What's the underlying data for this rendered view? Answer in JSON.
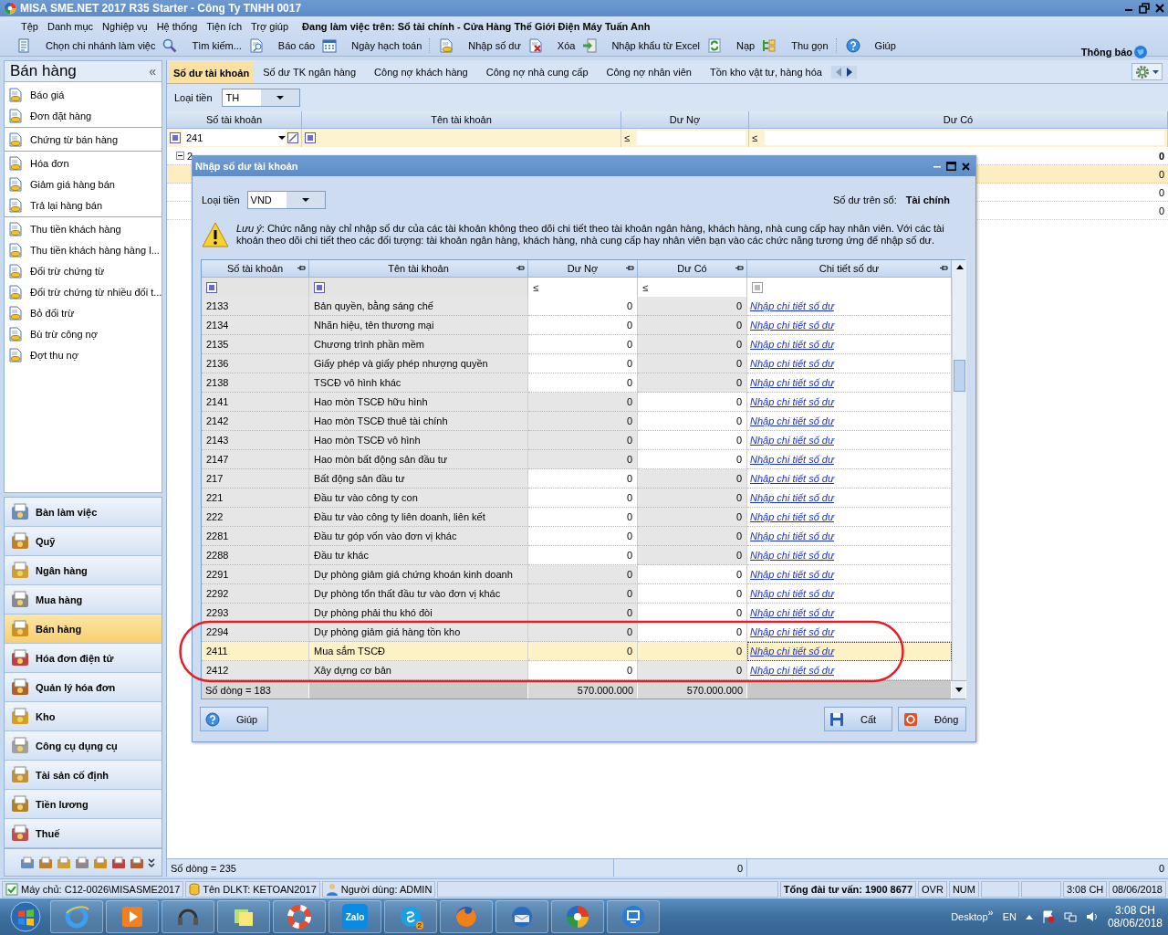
{
  "window": {
    "title": "MISA SME.NET 2017 R35 Starter - Công Ty TNHH 0017"
  },
  "menu": {
    "items": [
      "Tệp",
      "Danh mục",
      "Nghiệp vụ",
      "Hệ thống",
      "Tiện ích",
      "Trợ giúp"
    ],
    "context": "Đang làm việc trên: Sổ tài chính - Cửa Hàng Thế Giới Điện Máy Tuấn Anh"
  },
  "toolbar": {
    "groups": [
      [
        {
          "label": "Chọn chi nhánh làm việc",
          "kind": "branch"
        },
        {
          "label": "Tìm kiếm...",
          "kind": "search"
        },
        {
          "label": "Báo cáo",
          "kind": "report"
        },
        {
          "label": "Ngày hạch toán",
          "kind": "calendar"
        }
      ],
      [
        {
          "label": "Nhập số dư",
          "kind": "balance"
        },
        {
          "label": "Xóa",
          "kind": "delete"
        },
        {
          "label": "Nhập khẩu từ Excel",
          "kind": "import"
        },
        {
          "label": "Nạp",
          "kind": "refresh"
        },
        {
          "label": "Thu gọn",
          "kind": "collapse"
        }
      ],
      [
        {
          "label": "Giúp",
          "kind": "help"
        }
      ]
    ],
    "notification": "Thông báo"
  },
  "sidebar": {
    "title": "Bán hàng",
    "collapse": "«",
    "groups": [
      [
        "Báo giá",
        "Đơn đặt hàng"
      ],
      [
        "Chứng từ bán hàng"
      ],
      [
        "Hóa đơn",
        "Giảm giá hàng bán",
        "Trả lại hàng bán"
      ],
      [
        "Thu tiền khách hàng",
        "Thu tiền khách hàng hàng l...",
        "Đối trừ chứng từ",
        "Đối trừ chứng từ nhiều đối t...",
        "Bỏ đối trừ",
        "Bù trừ công nợ",
        "Đợt thu nợ"
      ]
    ],
    "modules": [
      {
        "label": "Bàn làm việc",
        "selected": false
      },
      {
        "label": "Quỹ",
        "selected": false
      },
      {
        "label": "Ngân hàng",
        "selected": false
      },
      {
        "label": "Mua hàng",
        "selected": false
      },
      {
        "label": "Bán hàng",
        "selected": true
      },
      {
        "label": "Hóa đơn điện tử",
        "selected": false
      },
      {
        "label": "Quản lý hóa đơn",
        "selected": false
      },
      {
        "label": "Kho",
        "selected": false
      },
      {
        "label": "Công cụ dụng cụ",
        "selected": false
      },
      {
        "label": "Tài sản cố định",
        "selected": false
      },
      {
        "label": "Tiền lương",
        "selected": false
      },
      {
        "label": "Thuế",
        "selected": false
      }
    ]
  },
  "tabs": [
    {
      "label": "Số dư tài khoản",
      "selected": true
    },
    {
      "label": "Số dư TK ngân hàng",
      "selected": false
    },
    {
      "label": "Công nợ khách hàng",
      "selected": false
    },
    {
      "label": "Công nợ nhà cung cấp",
      "selected": false
    },
    {
      "label": "Công nợ nhân viên",
      "selected": false
    },
    {
      "label": "Tồn kho vật tư, hàng hóa",
      "selected": false
    }
  ],
  "currency": {
    "label": "Loại tiền",
    "value": "TH"
  },
  "grid": {
    "columns": [
      "Số tài khoản",
      "Tên tài khoản",
      "Dư Nợ",
      "Dư Có"
    ],
    "filter_value": "241",
    "filter_ops": [
      "≤",
      "≤"
    ],
    "rows": [
      {
        "kind": "group",
        "label": "2",
        "expanded": true,
        "credit": "0",
        "selected": false
      },
      {
        "kind": "row",
        "credit": "0",
        "selected": true
      },
      {
        "kind": "row",
        "credit": "0",
        "selected": false
      },
      {
        "kind": "row",
        "credit": "0",
        "selected": false
      }
    ],
    "footer": {
      "count": "Số dòng = 235",
      "debit": "0",
      "credit": "0"
    }
  },
  "dialog": {
    "title": "Nhập số dư tài khoản",
    "currency_label": "Loại tiền",
    "currency": "VND",
    "book_label": "Số dư trên sổ:",
    "book": "Tài chính",
    "note": "*Lưu ý*: Chức năng này chỉ nhập số dư của các tài khoản không theo dõi chi tiết theo tài khoản ngân hàng, khách hàng, nhà cung cấp hay nhân viên. Với các tài khoản theo dõi chi tiết theo các đối tượng: tài khoản ngân hàng, khách hàng, nhà cung cấp hay nhân viên bạn vào các chức năng tương ứng để nhập số dư.",
    "columns": [
      "Số tài khoản",
      "Tên tài khoản",
      "Dư Nợ",
      "Dư Có",
      "Chi tiết số dư"
    ],
    "filter_ops": [
      "≤",
      "≤"
    ],
    "rows": [
      {
        "account": "2133",
        "name": "Bản quyền, bằng sáng chế",
        "debit": "0",
        "credit": "0",
        "detail": "Nhập chi tiết số dư",
        "debit_open": true,
        "selected": false
      },
      {
        "account": "2134",
        "name": "Nhãn hiệu, tên thương mại",
        "debit": "0",
        "credit": "0",
        "detail": "Nhập chi tiết số dư",
        "debit_open": true,
        "selected": false
      },
      {
        "account": "2135",
        "name": "Chương trình phần mềm",
        "debit": "0",
        "credit": "0",
        "detail": "Nhập chi tiết số dư",
        "debit_open": true,
        "selected": false
      },
      {
        "account": "2136",
        "name": "Giấy phép và giấy phép nhượng quyền",
        "debit": "0",
        "credit": "0",
        "detail": "Nhập chi tiết số dư",
        "debit_open": true,
        "selected": false
      },
      {
        "account": "2138",
        "name": "TSCĐ vô hình khác",
        "debit": "0",
        "credit": "0",
        "detail": "Nhập chi tiết số dư",
        "debit_open": true,
        "selected": false
      },
      {
        "account": "2141",
        "name": "Hao mòn TSCĐ hữu hình",
        "debit": "0",
        "credit": "0",
        "detail": "Nhập chi tiết số dư",
        "debit_open": false,
        "selected": false
      },
      {
        "account": "2142",
        "name": "Hao mòn TSCĐ thuê tài chính",
        "debit": "0",
        "credit": "0",
        "detail": "Nhập chi tiết số dư",
        "debit_open": false,
        "selected": false
      },
      {
        "account": "2143",
        "name": "Hao mòn TSCĐ vô hình",
        "debit": "0",
        "credit": "0",
        "detail": "Nhập chi tiết số dư",
        "debit_open": false,
        "selected": false
      },
      {
        "account": "2147",
        "name": "Hao mòn bất động sản đầu tư",
        "debit": "0",
        "credit": "0",
        "detail": "Nhập chi tiết số dư",
        "debit_open": false,
        "selected": false
      },
      {
        "account": "217",
        "name": "Bất động sản đầu tư",
        "debit": "0",
        "credit": "0",
        "detail": "Nhập chi tiết số dư",
        "debit_open": true,
        "selected": false
      },
      {
        "account": "221",
        "name": "Đầu tư vào công ty con",
        "debit": "0",
        "credit": "0",
        "detail": "Nhập chi tiết số dư",
        "debit_open": true,
        "selected": false
      },
      {
        "account": "222",
        "name": "Đầu tư vào công ty liên doanh, liên kết",
        "debit": "0",
        "credit": "0",
        "detail": "Nhập chi tiết số dư",
        "debit_open": true,
        "selected": false
      },
      {
        "account": "2281",
        "name": "Đầu tư góp vốn vào đơn vị khác",
        "debit": "0",
        "credit": "0",
        "detail": "Nhập chi tiết số dư",
        "debit_open": true,
        "selected": false
      },
      {
        "account": "2288",
        "name": "Đầu tư khác",
        "debit": "0",
        "credit": "0",
        "detail": "Nhập chi tiết số dư",
        "debit_open": true,
        "selected": false
      },
      {
        "account": "2291",
        "name": "Dự phòng giảm giá chứng khoán kinh doanh",
        "debit": "0",
        "credit": "0",
        "detail": "Nhập chi tiết số dư",
        "debit_open": false,
        "selected": false
      },
      {
        "account": "2292",
        "name": "Dự phòng tổn thất đầu tư vào đơn vị khác",
        "debit": "0",
        "credit": "0",
        "detail": "Nhập chi tiết số dư",
        "debit_open": false,
        "selected": false
      },
      {
        "account": "2293",
        "name": "Dự phòng phải thu khó đòi",
        "debit": "0",
        "credit": "0",
        "detail": "Nhập chi tiết số dư",
        "debit_open": false,
        "selected": false
      },
      {
        "account": "2294",
        "name": "Dự phòng giảm giá hàng tồn kho",
        "debit": "0",
        "credit": "0",
        "detail": "Nhập chi tiết số dư",
        "debit_open": false,
        "selected": false
      },
      {
        "account": "2411",
        "name": "Mua sắm TSCĐ",
        "debit": "0",
        "credit": "0",
        "detail": "Nhập chi tiết số dư",
        "debit_open": true,
        "selected": true
      },
      {
        "account": "2412",
        "name": "Xây dựng cơ bản",
        "debit": "0",
        "credit": "0",
        "detail": "Nhập chi tiết số dư",
        "debit_open": true,
        "selected": false
      }
    ],
    "footer": {
      "count": "Số dòng = 183",
      "debit": "570.000.000",
      "credit": "570.000.000"
    },
    "buttons": [
      {
        "label": "Giúp",
        "kind": "help"
      },
      {
        "label": "Cất",
        "kind": "save"
      },
      {
        "label": "Đóng",
        "kind": "close"
      }
    ]
  },
  "status_bar": {
    "server": "Máy chủ: C12-0026\\MISASME2017",
    "database": "Tên DLKT: KETOAN2017",
    "user": "Người dùng: ADMIN",
    "hotline": "Tổng đài tư vấn: 1900 8677",
    "keys": [
      "OVR",
      "NUM"
    ],
    "time": "3:08 CH",
    "date": "08/06/2018"
  },
  "taskbar": {
    "apps": [
      {
        "kind": "ie"
      },
      {
        "kind": "media"
      },
      {
        "kind": "headset"
      },
      {
        "kind": "notes"
      },
      {
        "kind": "lifebuoy"
      },
      {
        "kind": "zalo",
        "label": "Zalo"
      },
      {
        "kind": "skype",
        "badge": "2"
      },
      {
        "kind": "firefox"
      },
      {
        "kind": "mail"
      },
      {
        "kind": "misa"
      },
      {
        "kind": "remote"
      }
    ],
    "desktop": "Desktop",
    "more": "»",
    "language": "EN",
    "time": "3:08 CH",
    "date": "08/06/2018"
  }
}
